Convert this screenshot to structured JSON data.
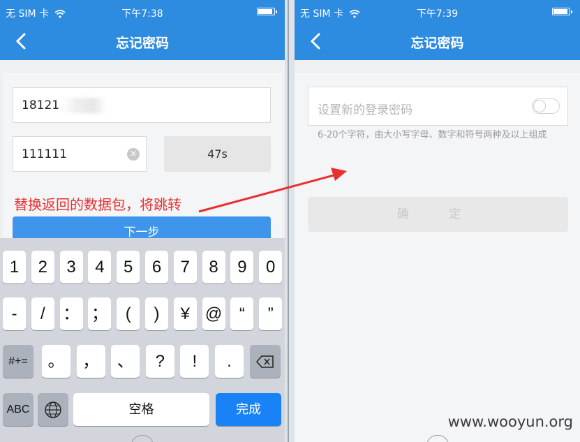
{
  "left": {
    "status": {
      "carrier": "无 SIM 卡",
      "time": "下午7:38"
    },
    "nav": {
      "title": "忘记密码"
    },
    "phone_value": "18121",
    "code_value": "111111",
    "countdown_label": "47s",
    "annotation": "替换返回的数据包，将跳转",
    "next_button": "下一步",
    "keyboard": {
      "row1": [
        "1",
        "2",
        "3",
        "4",
        "5",
        "6",
        "7",
        "8",
        "9",
        "0"
      ],
      "row2": [
        "-",
        "/",
        "：",
        "；",
        "(",
        ")",
        "¥",
        "@",
        "“",
        "”"
      ],
      "row3_mode": "#+=",
      "row3": [
        "。",
        "，",
        "、",
        "?",
        "!",
        "."
      ],
      "abc": "ABC",
      "space": "空格",
      "done": "完成"
    }
  },
  "right": {
    "status": {
      "carrier": "无 SIM 卡",
      "time": "下午7:39"
    },
    "nav": {
      "title": "忘记密码"
    },
    "password_placeholder": "设置新的登录密码",
    "hint": "6-20个字符，由大小写字母、数字和符号两种及以上组成",
    "confirm_button": "确 定"
  },
  "watermark": "www.wooyun.org",
  "colors": {
    "header": "#2d8be0",
    "annotation": "#e8302f",
    "done_key": "#1a82f7"
  }
}
